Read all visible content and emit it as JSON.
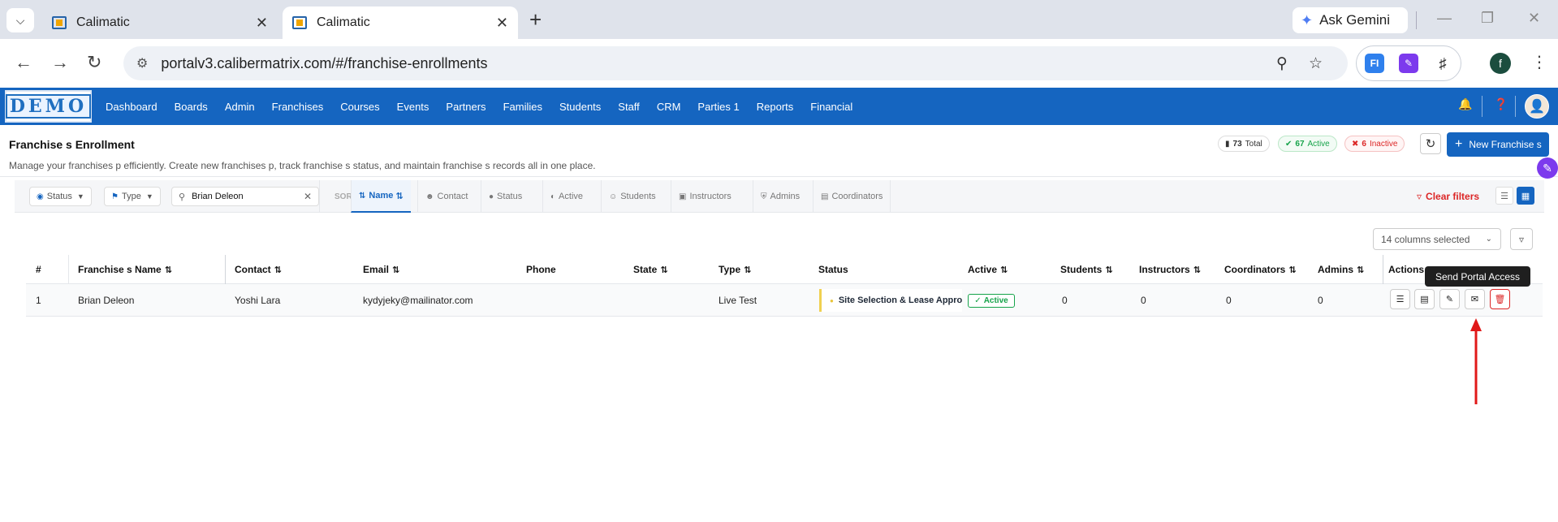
{
  "browser": {
    "tabs": [
      {
        "title": "Calimatic",
        "active": false
      },
      {
        "title": "Calimatic",
        "active": true
      }
    ],
    "gemini_label": "Ask Gemini",
    "url": "portalv3.calibermatrix.com/#/franchise-enrollments",
    "profile_initial": "f"
  },
  "app": {
    "logo_text": "DEMO",
    "nav": [
      "Dashboard",
      "Boards",
      "Admin",
      "Franchises",
      "Courses",
      "Events",
      "Partners",
      "Families",
      "Students",
      "Staff",
      "CRM",
      "Parties 1",
      "Reports",
      "Financial"
    ],
    "brand_color": "#1565c0"
  },
  "page": {
    "title": "Franchise s Enrollment",
    "subtitle": "Manage your franchises p efficiently. Create new franchises p, track franchise s status, and maintain franchise s records all in one place.",
    "stats": {
      "total_count": "73",
      "total_label": "Total",
      "active_count": "67",
      "active_label": "Active",
      "inactive_count": "6",
      "inactive_label": "Inactive"
    },
    "new_button": "New Franchise s"
  },
  "filters": {
    "status_label": "Status",
    "type_label": "Type",
    "search_value": "Brian Deleon",
    "sort_label": "SORT",
    "sort_items": [
      {
        "label": "Name",
        "icon": "sort-icon",
        "active": true
      },
      {
        "label": "Contact",
        "icon": "user-icon",
        "active": false
      },
      {
        "label": "Status",
        "icon": "circle-icon",
        "active": false
      },
      {
        "label": "Active",
        "icon": "toggle-icon",
        "active": false
      },
      {
        "label": "Students",
        "icon": "users-icon",
        "active": false
      },
      {
        "label": "Instructors",
        "icon": "chalkboard-icon",
        "active": false
      },
      {
        "label": "Admins",
        "icon": "shield-icon",
        "active": false
      },
      {
        "label": "Coordinators",
        "icon": "briefcase-icon",
        "active": false
      }
    ],
    "clear_label": "Clear filters"
  },
  "table": {
    "columns_selected": "14 columns selected",
    "headers": {
      "num": "#",
      "name": "Franchise s Name",
      "contact": "Contact",
      "email": "Email",
      "phone": "Phone",
      "state": "State",
      "type": "Type",
      "status": "Status",
      "active": "Active",
      "students": "Students",
      "instructors": "Instructors",
      "coordinators": "Coordinators",
      "admins": "Admins",
      "actions": "Actions"
    },
    "rows": [
      {
        "num": "1",
        "name": "Brian Deleon",
        "contact": "Yoshi Lara",
        "email": "kydyjeky@mailinator.com",
        "phone": "",
        "state": "",
        "type": "Live Test",
        "status": "Site Selection & Lease Appro",
        "active": "Active",
        "students": "0",
        "instructors": "0",
        "coordinators": "0",
        "admins": "0"
      }
    ]
  },
  "tooltip": "Send Portal Access"
}
